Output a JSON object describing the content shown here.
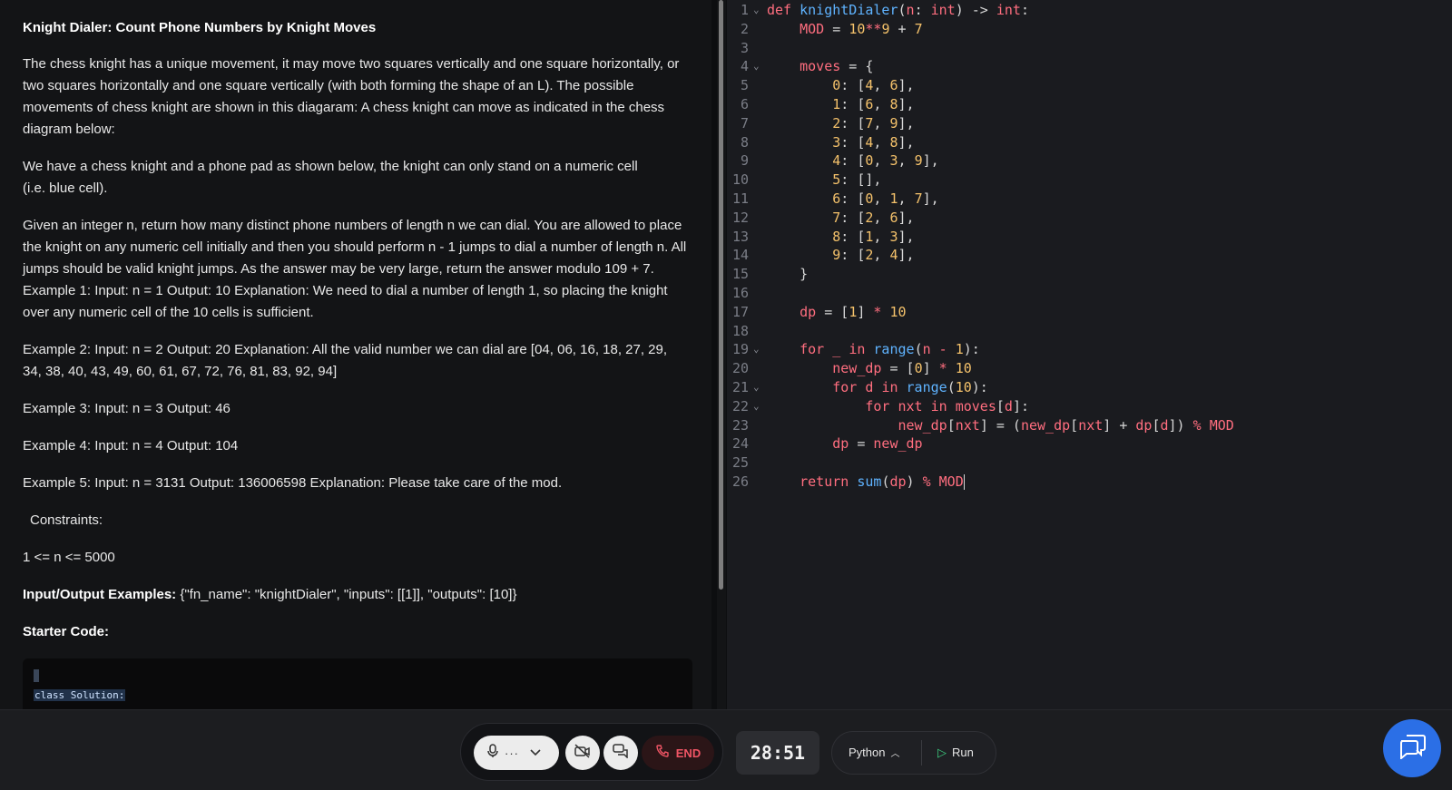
{
  "problem": {
    "title": "Knight Dialer: Count Phone Numbers by Knight Moves",
    "paragraphs": [
      "The chess knight has a unique movement, it may move two squares vertically and one square horizontally, or two squares horizontally and one square vertically (with both forming the shape of an L). The possible movements of chess knight are shown in this diagaram: A chess knight can move as indicated in the chess diagram below:",
      "We have a chess knight and a phone pad as shown below, the knight can only stand on a numeric cell (i.e. blue cell).",
      "Given an integer n, return how many distinct phone numbers of length n we can dial. You are allowed to place the knight on any numeric cell initially and then you should perform n - 1 jumps to dial a number of length n. All jumps should be valid knight jumps. As the answer may be very large, return the answer modulo 109 + 7.   Example 1: Input: n = 1 Output: 10 Explanation: We need to dial a number of length 1, so placing the knight over any numeric cell of the 10 cells is sufficient.",
      "Example 2: Input: n = 2 Output: 20 Explanation: All the valid number we can dial are [04, 06, 16, 18, 27, 29, 34, 38, 40, 43, 49, 60, 61, 67, 72, 76, 81, 83, 92, 94]",
      "Example 3: Input: n = 3 Output: 46",
      "Example 4: Input: n = 4 Output: 104",
      "Example 5: Input: n = 3131 Output: 136006598 Explanation: Please take care of the mod."
    ],
    "constraints_label": "Constraints:",
    "constraint": "1 <= n <= 5000",
    "io_label": "Input/Output Examples:",
    "io_value": " {\"fn_name\": \"knightDialer\", \"inputs\": [[1]], \"outputs\": [10]}",
    "starter_label": "Starter Code:",
    "starter_code": "class Solution:"
  },
  "editor": {
    "line_numbers": [
      "1",
      "2",
      "3",
      "4",
      "5",
      "6",
      "7",
      "8",
      "9",
      "10",
      "11",
      "12",
      "13",
      "14",
      "15",
      "16",
      "17",
      "18",
      "19",
      "20",
      "21",
      "22",
      "23",
      "24",
      "25",
      "26"
    ]
  },
  "controls": {
    "end_label": "END",
    "timer": "28:51",
    "language": "Python",
    "run_label": "Run"
  },
  "colors": {
    "accent_blue": "#2b6fe6",
    "end_red": "#f05565",
    "run_green": "#3ccb7f"
  }
}
